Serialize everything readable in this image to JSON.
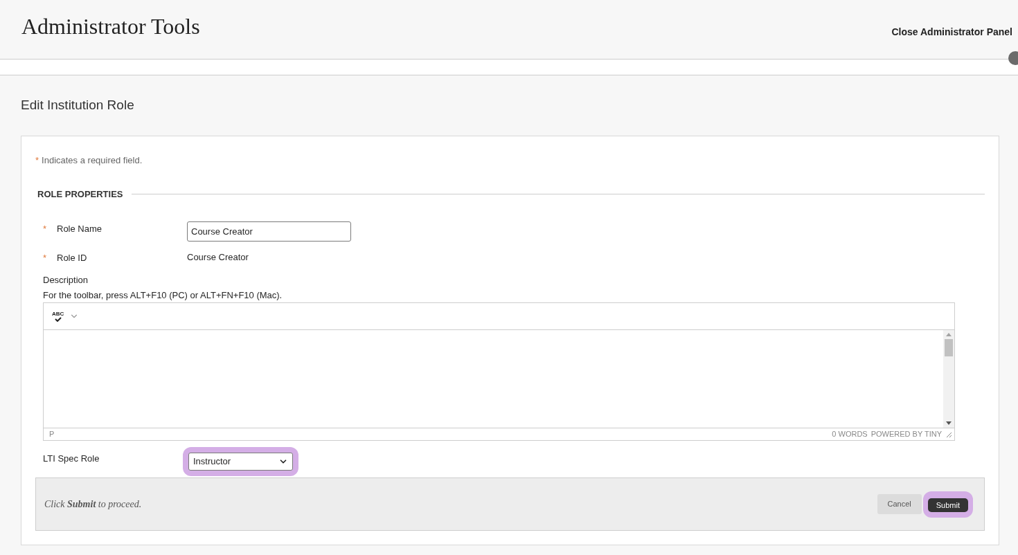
{
  "header": {
    "title": "Administrator Tools",
    "close_link": "Close Administrator Panel"
  },
  "page_title": "Edit Institution Role",
  "required_note": {
    "mark": "*",
    "text": "Indicates a required field."
  },
  "section": {
    "title": "ROLE PROPERTIES"
  },
  "fields": [
    {
      "kind": "text",
      "required": true,
      "label": "Role Name",
      "value": "Course Creator"
    },
    {
      "kind": "static",
      "required": true,
      "label": "Role ID",
      "value": "Course Creator"
    }
  ],
  "description": {
    "label": "Description",
    "hint": "For the toolbar, press ALT+F10 (PC) or ALT+FN+F10 (Mac).",
    "spellcheck_label": "ABC",
    "path": "P",
    "word_count": "0 WORDS",
    "powered_by": "POWERED BY TINY"
  },
  "lti": {
    "label": "LTI Spec Role",
    "value": "Instructor",
    "highlighted": true
  },
  "submit_bar": {
    "text": "Click **Submit** to proceed.",
    "buttons": [
      {
        "kind": "secondary",
        "label": "Cancel",
        "highlighted": false
      },
      {
        "kind": "primary",
        "label": "Submit",
        "highlighted": true
      }
    ]
  }
}
